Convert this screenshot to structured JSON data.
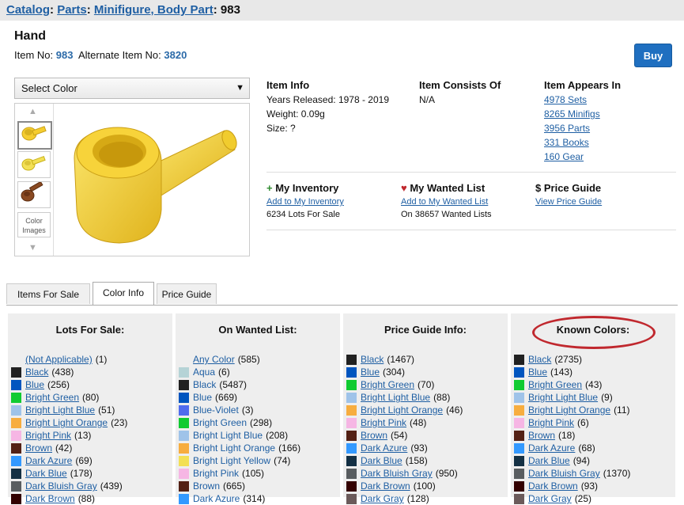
{
  "breadcrumb": {
    "catalog": "Catalog",
    "parts": "Parts",
    "category": "Minifigure, Body Part",
    "item": "983",
    "sep": ":"
  },
  "item": {
    "title": "Hand",
    "item_no_label": "Item No:",
    "item_no": "983",
    "alt_label": "Alternate Item No:",
    "alt_no": "3820",
    "buy": "Buy"
  },
  "color_select": {
    "value": "Select Color",
    "arrow": "▼"
  },
  "thumbs": {
    "color_images_line1": "Color",
    "color_images_line2": "Images"
  },
  "colors": {
    "yellow": "#f5cd2f",
    "yellow_dark": "#d9b21f",
    "brown": "#8a4a22"
  },
  "item_info": {
    "heading": "Item Info",
    "years": "Years Released: 1978 - 2019",
    "weight": "Weight: 0.09g",
    "size": "Size: ?"
  },
  "consists": {
    "heading": "Item Consists Of",
    "value": "N/A"
  },
  "appears": {
    "heading": "Item Appears In",
    "links": [
      "4978 Sets",
      "8265 Minifigs",
      "3956 Parts",
      "331 Books",
      "160 Gear"
    ]
  },
  "inventory": {
    "icon": "+",
    "heading": "My Inventory",
    "link": "Add to My Inventory",
    "stat": "6234 Lots For Sale"
  },
  "wanted": {
    "icon": "♥",
    "heading": "My Wanted List",
    "link": "Add to My Wanted List",
    "stat": "On 38657 Wanted Lists"
  },
  "price": {
    "icon": "$",
    "heading": "Price Guide",
    "link": "View Price Guide"
  },
  "tabs": [
    "Items For Sale",
    "Color Info",
    "Price Guide"
  ],
  "panels": [
    {
      "title": "Lots For Sale:",
      "rows": [
        {
          "name": "(Not Applicable)",
          "count": "(1)",
          "color": "none"
        },
        {
          "name": "Black",
          "count": "(438)",
          "color": "#212121"
        },
        {
          "name": "Blue",
          "count": "(256)",
          "color": "#0055bf"
        },
        {
          "name": "Bright Green",
          "count": "(80)",
          "color": "#10cb31"
        },
        {
          "name": "Bright Light Blue",
          "count": "(51)",
          "color": "#9fc3e9"
        },
        {
          "name": "Bright Light Orange",
          "count": "(23)",
          "color": "#f7ad3f"
        },
        {
          "name": "Bright Pink",
          "count": "(13)",
          "color": "#f6b6e4"
        },
        {
          "name": "Brown",
          "count": "(42)",
          "color": "#532115"
        },
        {
          "name": "Dark Azure",
          "count": "(69)",
          "color": "#3399ff"
        },
        {
          "name": "Dark Blue",
          "count": "(178)",
          "color": "#143044"
        },
        {
          "name": "Dark Bluish Gray",
          "count": "(439)",
          "color": "#595d60"
        },
        {
          "name": "Dark Brown",
          "count": "(88)",
          "color": "#330000"
        }
      ]
    },
    {
      "title": "On Wanted List:",
      "rows": [
        {
          "name": "Any Color",
          "count": "(585)",
          "color": "none"
        },
        {
          "name": "Aqua",
          "count": "(6)",
          "color": "#b5d3d6"
        },
        {
          "name": "Black",
          "count": "(5487)",
          "color": "#212121"
        },
        {
          "name": "Blue",
          "count": "(669)",
          "color": "#0055bf"
        },
        {
          "name": "Blue-Violet",
          "count": "(3)",
          "color": "#506cef"
        },
        {
          "name": "Bright Green",
          "count": "(298)",
          "color": "#10cb31"
        },
        {
          "name": "Bright Light Blue",
          "count": "(208)",
          "color": "#9fc3e9"
        },
        {
          "name": "Bright Light Orange",
          "count": "(166)",
          "color": "#f7ad3f"
        },
        {
          "name": "Bright Light Yellow",
          "count": "(74)",
          "color": "#f3e055"
        },
        {
          "name": "Bright Pink",
          "count": "(105)",
          "color": "#f6b6e4"
        },
        {
          "name": "Brown",
          "count": "(665)",
          "color": "#532115"
        },
        {
          "name": "Dark Azure",
          "count": "(314)",
          "color": "#3399ff"
        }
      ]
    },
    {
      "title": "Price Guide Info:",
      "rows": [
        {
          "name": "Black",
          "count": "(1467)",
          "color": "#212121"
        },
        {
          "name": "Blue",
          "count": "(304)",
          "color": "#0055bf"
        },
        {
          "name": "Bright Green",
          "count": "(70)",
          "color": "#10cb31"
        },
        {
          "name": "Bright Light Blue",
          "count": "(88)",
          "color": "#9fc3e9"
        },
        {
          "name": "Bright Light Orange",
          "count": "(46)",
          "color": "#f7ad3f"
        },
        {
          "name": "Bright Pink",
          "count": "(48)",
          "color": "#f6b6e4"
        },
        {
          "name": "Brown",
          "count": "(54)",
          "color": "#532115"
        },
        {
          "name": "Dark Azure",
          "count": "(93)",
          "color": "#3399ff"
        },
        {
          "name": "Dark Blue",
          "count": "(158)",
          "color": "#143044"
        },
        {
          "name": "Dark Bluish Gray",
          "count": "(950)",
          "color": "#595d60"
        },
        {
          "name": "Dark Brown",
          "count": "(100)",
          "color": "#330000"
        },
        {
          "name": "Dark Gray",
          "count": "(128)",
          "color": "#6b5a5a"
        }
      ]
    },
    {
      "title": "Known Colors:",
      "rows": [
        {
          "name": "Black",
          "count": "(2735)",
          "color": "#212121"
        },
        {
          "name": "Blue",
          "count": "(143)",
          "color": "#0055bf"
        },
        {
          "name": "Bright Green",
          "count": "(43)",
          "color": "#10cb31"
        },
        {
          "name": "Bright Light Blue",
          "count": "(9)",
          "color": "#9fc3e9"
        },
        {
          "name": "Bright Light Orange",
          "count": "(11)",
          "color": "#f7ad3f"
        },
        {
          "name": "Bright Pink",
          "count": "(6)",
          "color": "#f6b6e4"
        },
        {
          "name": "Brown",
          "count": "(18)",
          "color": "#532115"
        },
        {
          "name": "Dark Azure",
          "count": "(68)",
          "color": "#3399ff"
        },
        {
          "name": "Dark Blue",
          "count": "(94)",
          "color": "#143044"
        },
        {
          "name": "Dark Bluish Gray",
          "count": "(1370)",
          "color": "#595d60"
        },
        {
          "name": "Dark Brown",
          "count": "(93)",
          "color": "#330000"
        },
        {
          "name": "Dark Gray",
          "count": "(25)",
          "color": "#6b5a5a"
        }
      ]
    }
  ]
}
